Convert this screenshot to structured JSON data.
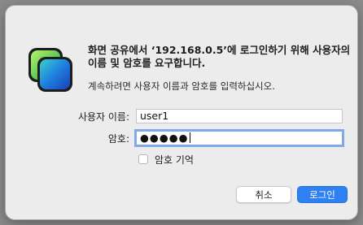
{
  "dialog": {
    "title": "화면 공유에서 ‘192.168.0.5’에 로그인하기 위해 사용자의 이름 및 암호를 요구합니다.",
    "subtitle": "계속하려면 사용자 이름과 암호를 입력하십시오.",
    "username_label": "사용자 이름:",
    "username_value": "user1",
    "password_label": "암호:",
    "password_masked": "●●●●●",
    "remember_label": "암호 기억",
    "remember_checked": false,
    "cancel_label": "취소",
    "login_label": "로그인",
    "accent_color": "#2f80f0",
    "app_icon": "screen-sharing-app-icon"
  }
}
